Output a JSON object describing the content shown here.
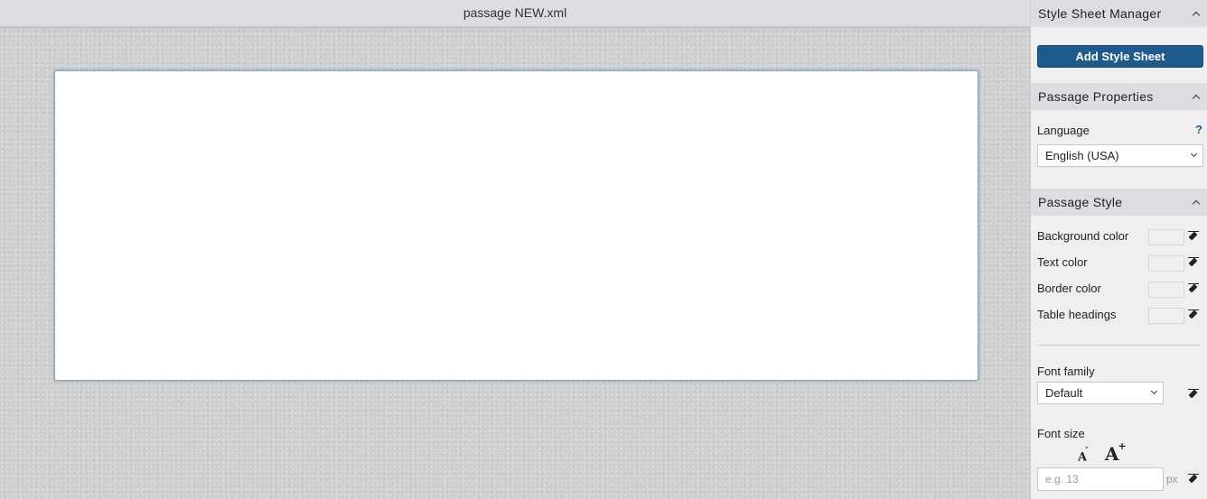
{
  "document": {
    "title": "passage NEW.xml"
  },
  "panel": {
    "style_sheet_manager": {
      "heading": "Style Sheet Manager",
      "add_button": "Add Style Sheet"
    },
    "passage_properties": {
      "heading": "Passage Properties",
      "language_label": "Language",
      "help_glyph": "?",
      "language_value": "English (USA)"
    },
    "passage_style": {
      "heading": "Passage Style",
      "rows": [
        {
          "label": "Background color",
          "icon": "eraser-icon"
        },
        {
          "label": "Text color",
          "icon": "eraser-icon"
        },
        {
          "label": "Border color",
          "icon": "eraser-icon"
        },
        {
          "label": "Table headings",
          "icon": "eraser-icon"
        }
      ],
      "font_family_label": "Font family",
      "font_family_value": "Default",
      "font_size_label": "Font size",
      "decrease_glyph": "A",
      "increase_glyph": "A",
      "increase_sup": "+",
      "decrease_sup": "-",
      "font_size_placeholder": "e.g. 13",
      "unit": "px"
    }
  },
  "colors": {
    "accent": "#1f5a8c",
    "panel_bg": "#efefef",
    "header_bg": "#dcdde0",
    "canvas_bg": "#cfcfcf"
  }
}
